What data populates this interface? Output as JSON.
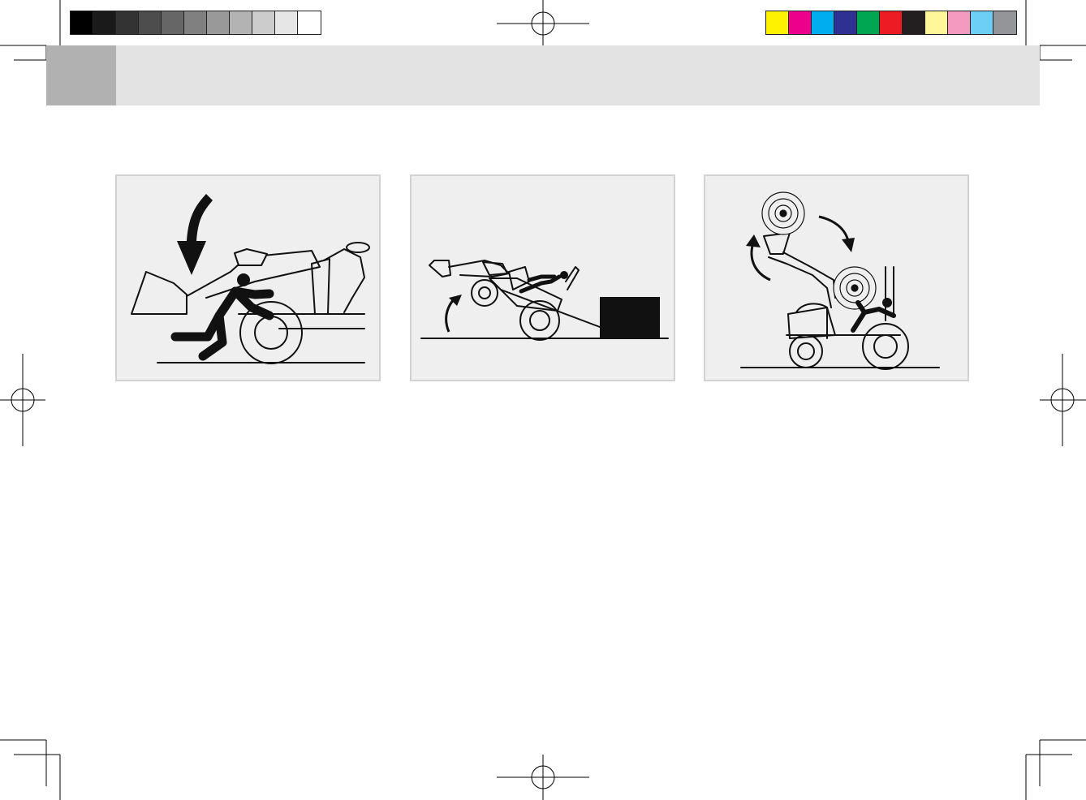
{
  "color_bar_left": [
    "#000000",
    "#1a1a1a",
    "#333333",
    "#4d4d4d",
    "#666666",
    "#808080",
    "#999999",
    "#b3b3b3",
    "#cccccc",
    "#e6e6e6",
    "#ffffff"
  ],
  "color_bar_right": [
    "#fff200",
    "#ec008c",
    "#00aeef",
    "#2e3192",
    "#00a651",
    "#ed1c24",
    "#231f20",
    "#fff799",
    "#f49ac1",
    "#6dcff6",
    "#939598"
  ],
  "header": {
    "band_color": "#e3e3e3",
    "tab_color": "#b1b1b1"
  },
  "illustrations": [
    {
      "icon": "bucket-falling-on-person-icon"
    },
    {
      "icon": "tractor-tipping-backward-icon"
    },
    {
      "icon": "bale-falling-on-operator-icon"
    }
  ]
}
